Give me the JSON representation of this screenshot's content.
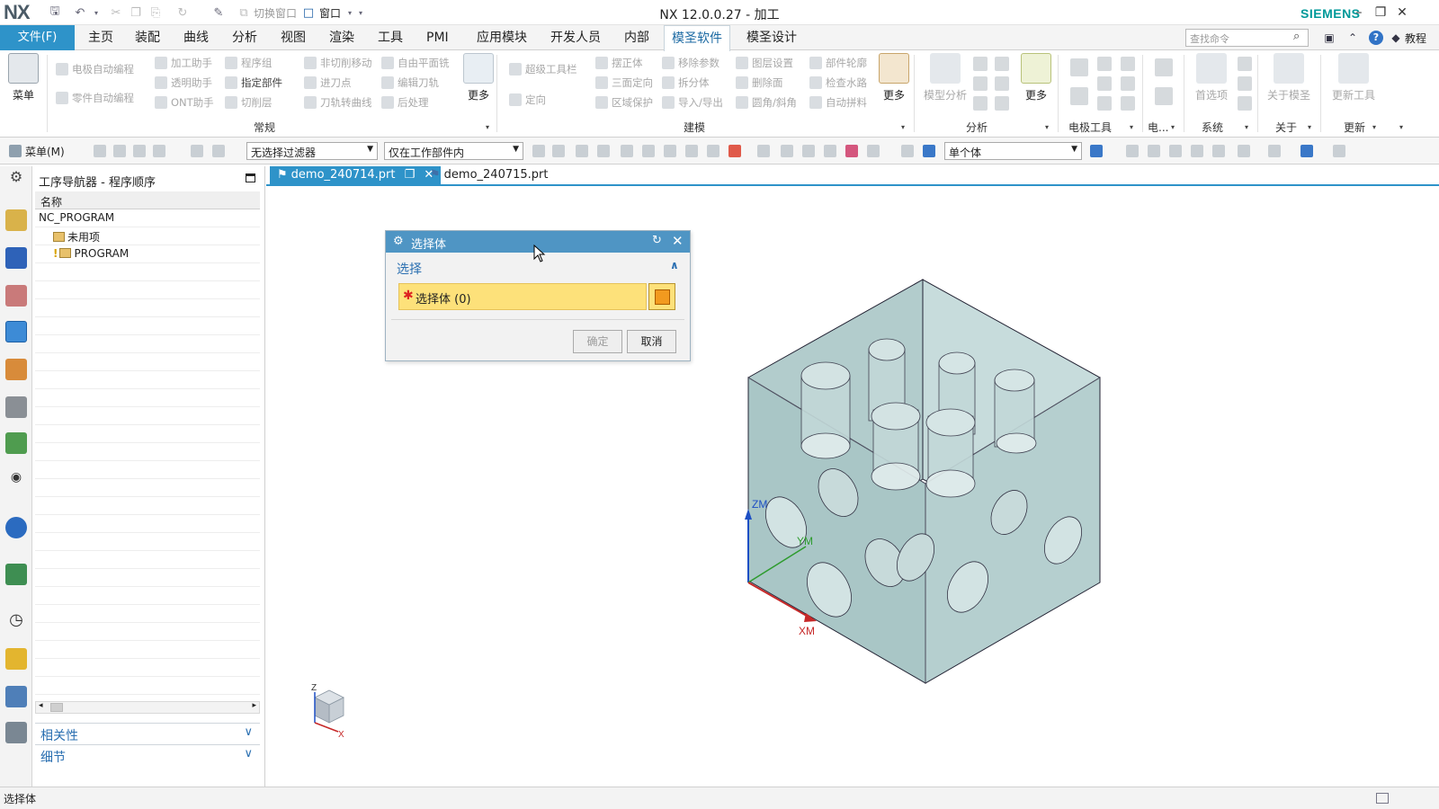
{
  "titlebar": {
    "logo": "NX",
    "quick_switch_window": "切换窗口",
    "window_menu": "窗口",
    "title": "NX 12.0.0.27 - 加工",
    "brand": "SIEMENS"
  },
  "menubar": {
    "file": "文件(F)",
    "tabs": [
      "主页",
      "装配",
      "曲线",
      "分析",
      "视图",
      "渲染",
      "工具",
      "PMI",
      "应用模块",
      "开发人员",
      "内部",
      "模圣软件",
      "模圣设计"
    ],
    "active_tab": "模圣软件",
    "search_placeholder": "查找命令",
    "tutorial": "教程"
  },
  "ribbon": {
    "menu_button": "菜单",
    "more_labels": [
      "更多",
      "更多",
      "更多"
    ],
    "col1": [
      "电极自动编程",
      "零件自动编程"
    ],
    "col2": [
      "加工助手",
      "透明助手",
      "ONT助手"
    ],
    "col3": [
      "程序组",
      "指定部件",
      "切削层"
    ],
    "col4": [
      "非切削移动",
      "进刀点",
      "刀轨转曲线"
    ],
    "col5": [
      "自由平面铣",
      "编辑刀轨",
      "后处理"
    ],
    "col6": [
      "超级工具栏",
      "定向"
    ],
    "col7": [
      "摆正体",
      "三面定向",
      "区域保护"
    ],
    "col8": [
      "移除参数",
      "拆分体",
      "导入/导出"
    ],
    "col9": [
      "图层设置",
      "删除面",
      "圆角/斜角"
    ],
    "col10": [
      "部件轮廓",
      "检查水路",
      "自动拼料"
    ],
    "model_analysis": "模型分析",
    "preferences": "首选项",
    "about_mosheng": "关于模圣",
    "update_tool": "更新工具",
    "groups": {
      "general": "常规",
      "modeling": "建模",
      "analysis": "分析",
      "electrode": "电极工具",
      "electrode_short": "电...",
      "system": "系统",
      "about": "关于",
      "update": "更新"
    }
  },
  "toolbar2": {
    "menu": "菜单(M)",
    "filter": "无选择过滤器",
    "scope": "仅在工作部件内",
    "body_mode": "单个体"
  },
  "navigator": {
    "title": "工序导航器 - 程序顺序",
    "column": "名称",
    "rows": [
      "NC_PROGRAM",
      "未用项",
      "PROGRAM"
    ],
    "sections": [
      "相关性",
      "细节"
    ]
  },
  "graphics": {
    "tabs": [
      "demo_240714.prt",
      "demo_240715.prt"
    ],
    "axes": {
      "zm": "ZM",
      "ym": "YM",
      "xm": "XM",
      "z": "Z",
      "x": "X"
    }
  },
  "dialog": {
    "title": "选择体",
    "section": "选择",
    "select_body": "选择体 (0)",
    "ok": "确定",
    "cancel": "取消"
  },
  "status": {
    "text": "选择体"
  },
  "colors": {
    "accent": "#2e93c9",
    "dialog_title": "#4f95c4",
    "selection_yellow": "#fde17a",
    "model_fill": "#b9d3d3",
    "brand": "#009999"
  }
}
